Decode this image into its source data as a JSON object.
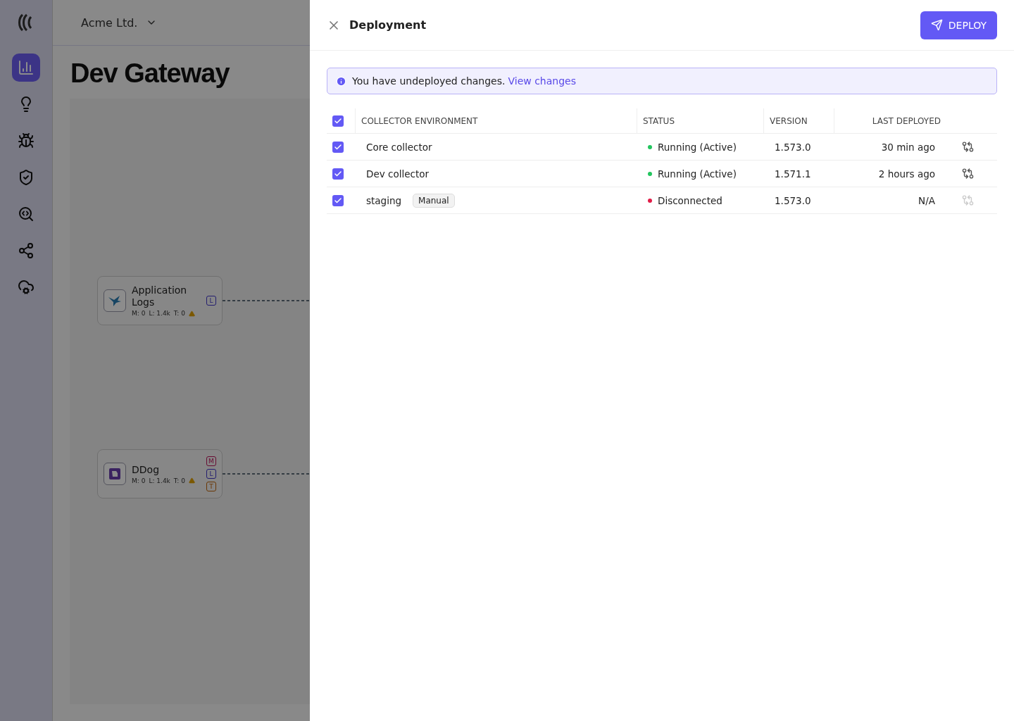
{
  "app": {
    "org": "Acme Ltd.",
    "title": "Dev Gateway",
    "nav": [
      {
        "selected": true
      },
      {
        "selected": false
      },
      {
        "selected": false
      },
      {
        "selected": false
      },
      {
        "selected": false
      },
      {
        "selected": false
      },
      {
        "selected": false
      }
    ],
    "nodes": [
      {
        "name": "Application Logs",
        "stats": [
          "M: 0",
          "L: 1.4k",
          "T: 0"
        ],
        "warning": true,
        "badges": [
          {
            "label": "L",
            "kind": "logs"
          }
        ]
      },
      {
        "name": "DDog",
        "stats": [
          "M: 0",
          "L: 1.4k",
          "T: 0"
        ],
        "warning": true,
        "badges": [
          {
            "label": "M",
            "kind": "metrics"
          },
          {
            "label": "L",
            "kind": "logs"
          },
          {
            "label": "T",
            "kind": "traces"
          }
        ]
      }
    ]
  },
  "drawer": {
    "title": "Deployment",
    "deploy_button": "DEPLOY",
    "notice": {
      "text": "You have undeployed changes.",
      "link": "View changes"
    },
    "table": {
      "all_checked": true,
      "columns": [
        "COLLECTOR ENVIRONMENT",
        "STATUS",
        "VERSION",
        "LAST DEPLOYED"
      ],
      "rows": [
        {
          "checked": true,
          "name": "Core collector",
          "status": "Running (Active)",
          "color": "#22c55e",
          "version": "1.573.0",
          "last_deployed": "30 min ago",
          "compare_enabled": true
        },
        {
          "checked": true,
          "name": "Dev collector",
          "status": "Running (Active)",
          "color": "#22c55e",
          "version": "1.571.1",
          "last_deployed": "2 hours ago",
          "compare_enabled": true
        },
        {
          "checked": true,
          "name": "staging",
          "tag": "Manual",
          "status": "Disconnected",
          "color": "#e11d48",
          "version": "1.573.0",
          "last_deployed": "N/A",
          "compare_enabled": false
        }
      ]
    }
  }
}
